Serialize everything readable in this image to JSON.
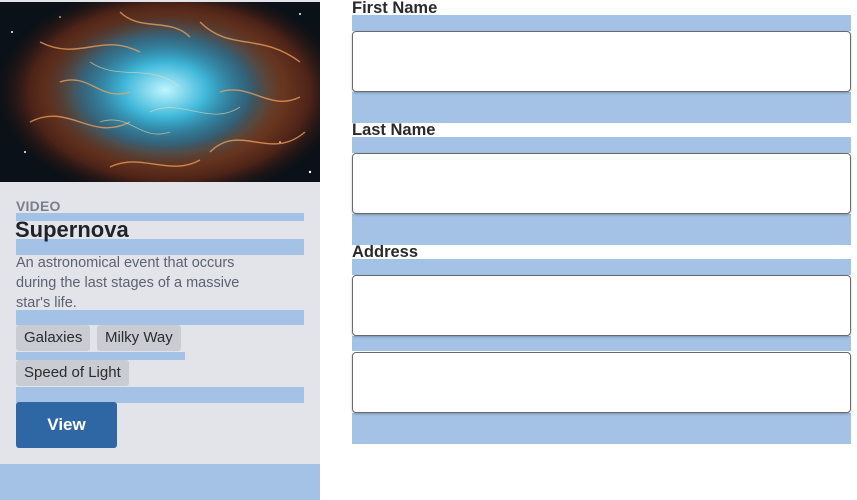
{
  "card": {
    "image_name": "crab-nebula-image",
    "type_label": "VIDEO",
    "title": "Supernova",
    "description": "An astronomical event that occurs during the last stages of a massive star's life.",
    "tags": [
      "Galaxies",
      "Milky Way",
      "Speed of Light"
    ],
    "view_label": "View"
  },
  "form": {
    "first_name_label": "First Name",
    "first_name_value": "",
    "last_name_label": "Last Name",
    "last_name_value": "",
    "address_label": "Address",
    "address_line1_value": "",
    "address_line2_value": ""
  },
  "colors": {
    "card_background": "#e2e4ea",
    "highlight": "#a3c2e6",
    "button": "#2f67a4",
    "tag_background": "#c9ccd3"
  }
}
